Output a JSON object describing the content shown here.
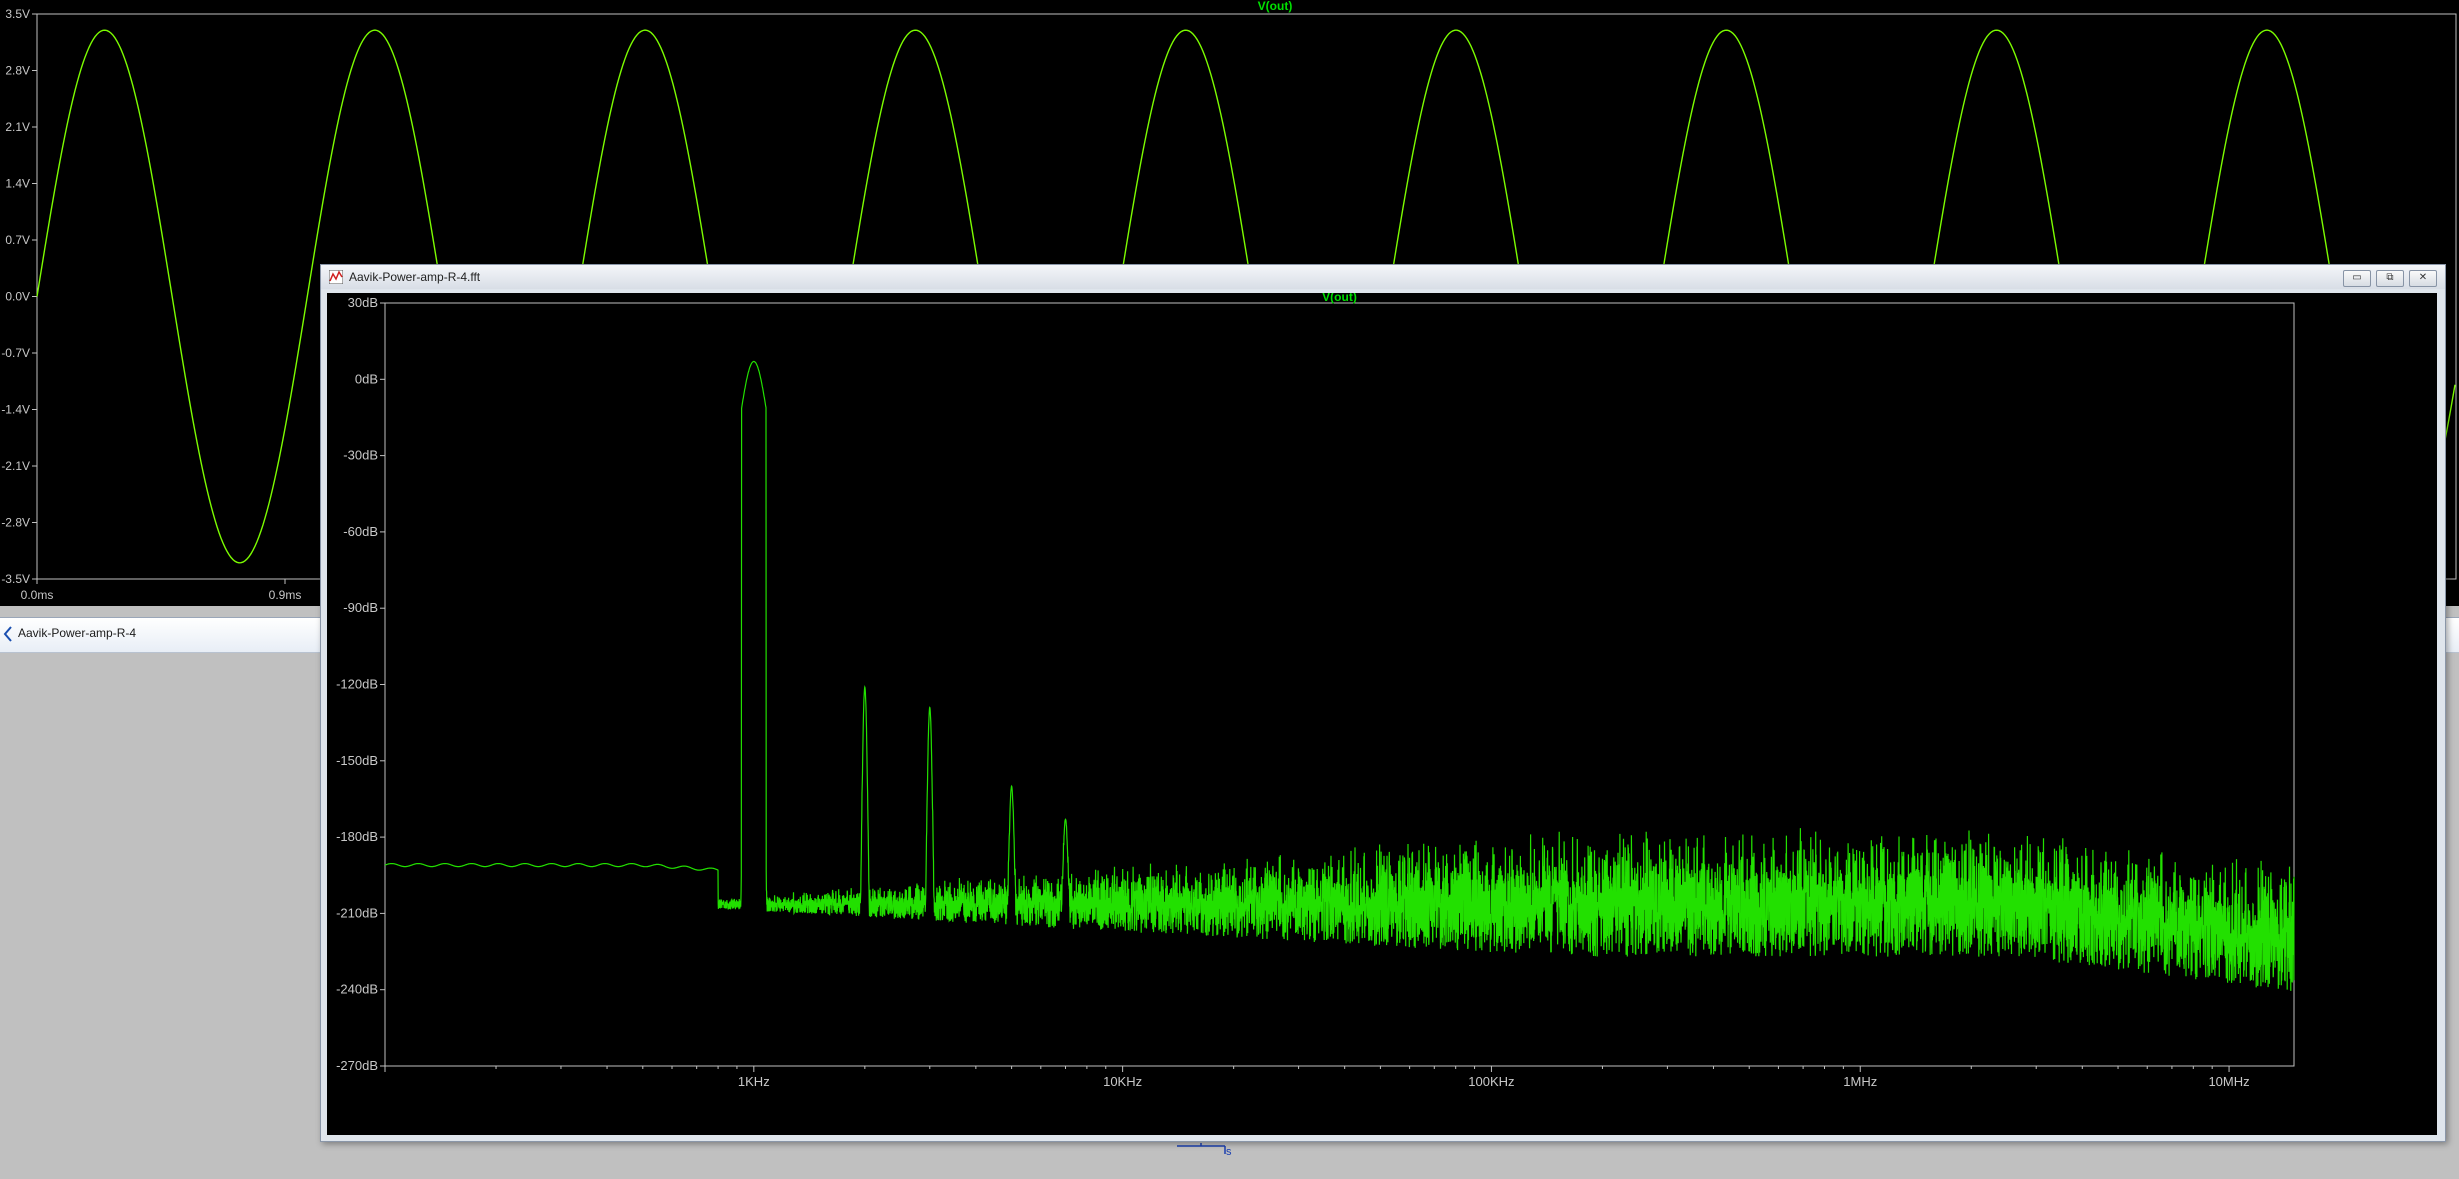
{
  "transient_plot": {
    "trace_label": "V(out)",
    "y_ticks": [
      "3.5V",
      "2.8V",
      "2.1V",
      "1.4V",
      "0.7V",
      "0.0V",
      "-0.7V",
      "-1.4V",
      "-2.1V",
      "-2.8V",
      "-3.5V"
    ],
    "x_ticks_visible": [
      "0.0ms",
      "0.9ms"
    ],
    "trace_color": "#7CFC00"
  },
  "schematic_window": {
    "title": "Aavik-Power-amp-R-4"
  },
  "fft_window": {
    "title": "Aavik-Power-amp-R-4.fft",
    "buttons": {
      "minimize": "▭",
      "restore": "⧉",
      "close": "✕"
    },
    "icon": "waveform-icon"
  },
  "chart_data": [
    {
      "type": "line",
      "title": "V(out)",
      "xlabel": "",
      "ylabel": "",
      "ylim": [
        -3.5,
        3.5
      ],
      "y_ticks": [
        3.5,
        2.8,
        2.1,
        1.4,
        0.7,
        0.0,
        -0.7,
        -1.4,
        -2.1,
        -2.8,
        -3.5
      ],
      "series": [
        {
          "name": "V(out)",
          "shape": "sine",
          "amplitude": 3.3,
          "cycles_visible": 8.95,
          "x_start_ms": 0.0
        }
      ],
      "x_tick_labels": [
        "0.0ms",
        "0.9ms"
      ],
      "grid": false
    },
    {
      "type": "line",
      "title": "V(out)",
      "xscale": "log",
      "xlim_hz": [
        100,
        15000000
      ],
      "ylim_db": [
        -270,
        30
      ],
      "y_ticks": [
        "30dB",
        "0dB",
        "-30dB",
        "-60dB",
        "-90dB",
        "-120dB",
        "-150dB",
        "-180dB",
        "-210dB",
        "-240dB",
        "-270dB"
      ],
      "x_ticks": [
        "1KHz",
        "10KHz",
        "100KHz",
        "1MHz",
        "10MHz"
      ],
      "series": [
        {
          "name": "V(out)",
          "noise_floor_db": -191,
          "peaks": [
            {
              "freq_hz": 1000,
              "level_db": 7
            },
            {
              "freq_hz": 2000,
              "level_db": -121
            },
            {
              "freq_hz": 3000,
              "level_db": -129
            },
            {
              "freq_hz": 5000,
              "level_db": -160
            },
            {
              "freq_hz": 7000,
              "level_db": -173
            }
          ]
        }
      ],
      "grid": false
    }
  ]
}
